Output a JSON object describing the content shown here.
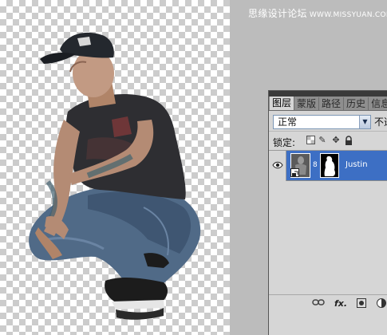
{
  "watermark": {
    "site_name": "思缘设计论坛",
    "url": "WWW.MISSYUAN.COM"
  },
  "canvas": {
    "subject": "crouching man in black cap and grey t-shirt on transparent background"
  },
  "layers_panel": {
    "tabs": [
      {
        "label": "图层",
        "active": true
      },
      {
        "label": "蒙版",
        "active": false
      },
      {
        "label": "路径",
        "active": false
      },
      {
        "label": "历史",
        "active": false
      },
      {
        "label": "信息",
        "active": false
      }
    ],
    "blend_mode": "正常",
    "opacity_label": "不透明度:",
    "lock_label": "锁定:",
    "layers": [
      {
        "name": "Justin",
        "selected": true,
        "visible": true
      }
    ],
    "icons": [
      "eye-icon",
      "lock-transparent-icon",
      "lock-brush-icon",
      "lock-move-icon",
      "lock-all-icon",
      "link-layers-icon",
      "fx-icon",
      "add-mask-icon",
      "adjustment-icon"
    ],
    "accent_color": "#3d6fc4"
  }
}
